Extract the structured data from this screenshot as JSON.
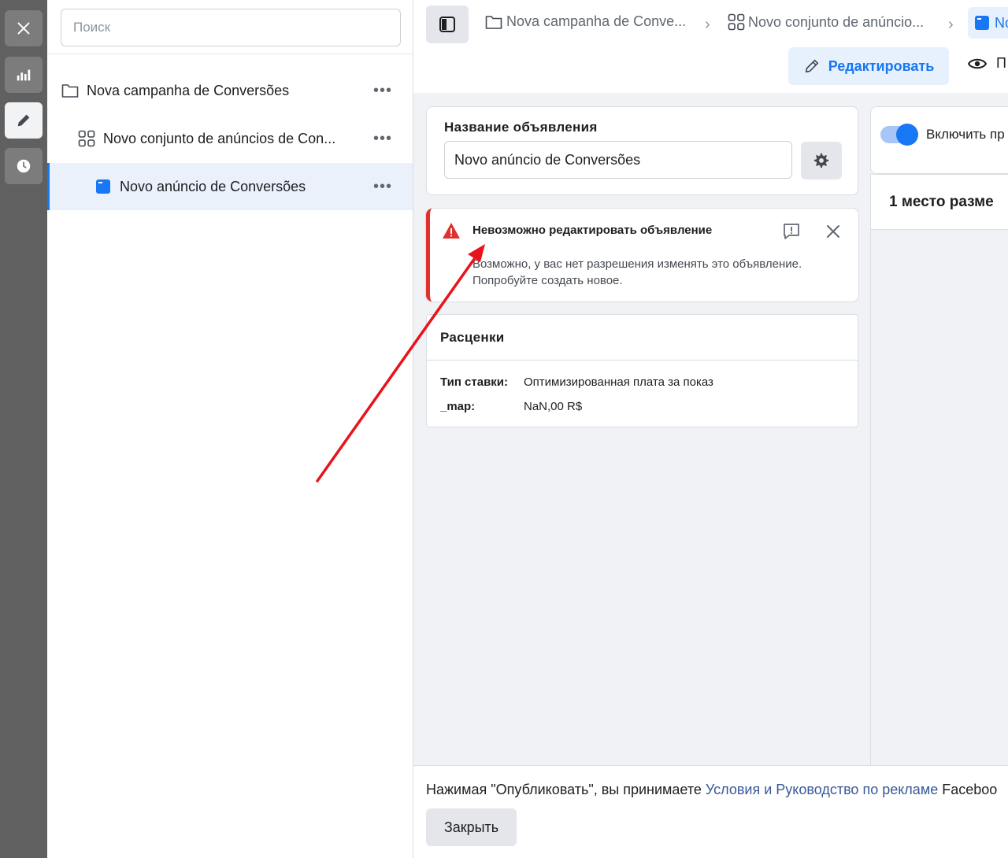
{
  "rail": {
    "items": [
      {
        "icon": "close-icon"
      },
      {
        "icon": "bar-chart-icon"
      },
      {
        "icon": "pencil-icon",
        "active": true
      },
      {
        "icon": "clock-icon"
      }
    ]
  },
  "tree": {
    "search_placeholder": "Поиск",
    "items": [
      {
        "label": "Nova campanha de Conversões",
        "icon": "folder-icon",
        "more": "•••"
      },
      {
        "label": "Novo conjunto de anúncios de Con...",
        "icon": "grid-icon",
        "more": "•••"
      },
      {
        "label": "Novo anúncio de Conversões",
        "icon": "ad-icon",
        "more": "•••",
        "selected": true
      }
    ]
  },
  "breadcrumb": {
    "items": [
      {
        "label": "Nova campanha de Conve...",
        "icon": "folder-icon"
      },
      {
        "label": "Novo conjunto de anúncio...",
        "icon": "grid-icon"
      },
      {
        "label": "No",
        "icon": "ad-icon"
      }
    ]
  },
  "toolbar": {
    "edit_label": "Редактировать",
    "preview_label": "П"
  },
  "ad_name": {
    "title": "Название объявления",
    "value": "Novo anúncio de Conversões"
  },
  "alert": {
    "title": "Невозможно редактировать объявление",
    "line1": "Возможно, у вас нет разрешения изменять это объявление.",
    "line2": "Попробуйте создать новое."
  },
  "pricing": {
    "title": "Расценки",
    "rows": [
      {
        "key": "Тип ставки:",
        "value": "Оптимизированная плата за показ"
      },
      {
        "key": "_map:",
        "value": "NaN,00 R$"
      }
    ]
  },
  "right_panel": {
    "toggle_label": "Включить пр",
    "placement_title": "1 место разме"
  },
  "footer": {
    "text_prefix": "Нажимая \"Опубликовать\", вы принимаете ",
    "link_text": "Условия и Руководство по рекламе",
    "text_suffix": " Faceboo",
    "close_label": "Закрыть"
  },
  "colors": {
    "accent": "#1877f2",
    "error": "#e0312e",
    "annotation_arrow": "#e8141b"
  }
}
